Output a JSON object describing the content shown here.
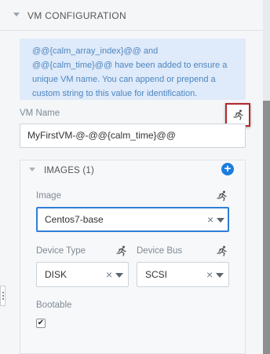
{
  "section": {
    "title": "VM CONFIGURATION"
  },
  "info": {
    "text": "@@{calm_array_index}@@ and @@{calm_time}@@ have been added to ensure a unique VM name. You can append or prepend a custom string to this value for identification."
  },
  "vm_name": {
    "label": "VM Name",
    "value": "MyFirstVM-@-@@{calm_time}@@",
    "runtime_icon": "runtime-editable-icon"
  },
  "images": {
    "title": "IMAGES (1)",
    "add_icon": "plus-circle-icon",
    "add_glyph": "+",
    "image_label": "Image",
    "image_value": "Centos7-base",
    "device_type_label": "Device Type",
    "device_type_value": "DISK",
    "device_bus_label": "Device Bus",
    "device_bus_value": "SCSI",
    "bootable_label": "Bootable",
    "bootable_checked": true,
    "check_glyph": "✔",
    "clear_glyph": "×"
  },
  "colors": {
    "accent": "#1c7ce0",
    "highlight_border": "#b3282d",
    "info_bg": "#dfeafa",
    "info_text": "#4d86bf"
  }
}
